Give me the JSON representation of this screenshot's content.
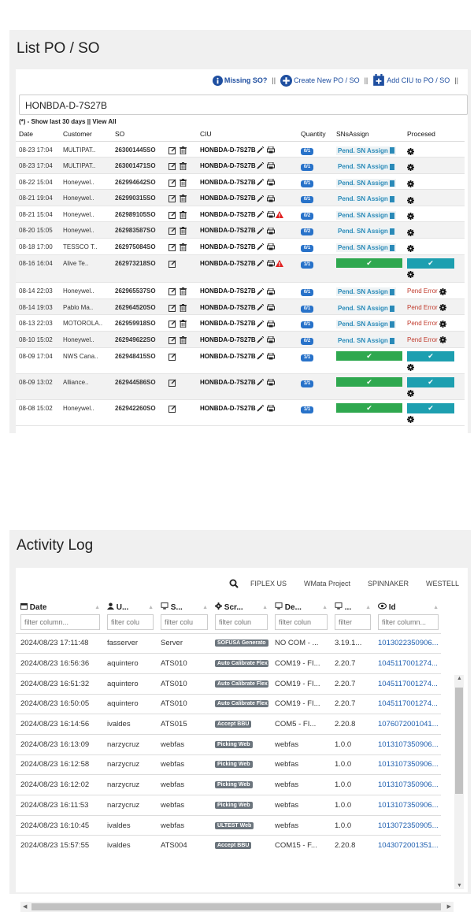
{
  "po_panel": {
    "title": "List PO / SO",
    "toolbar": {
      "missing": "Missing SO?",
      "create": "Create New PO / SO",
      "add_ciu": "Add CIU to PO / SO",
      "sep": "||"
    },
    "search_value": "HONBDA-D-7S27B",
    "show_last": "(*) - Show last 30 days || View All",
    "columns": [
      "Date",
      "Customer",
      "SO",
      "CIU",
      "Quantity",
      "SNsAssign",
      "Procesed"
    ],
    "rows": [
      {
        "date": "08-23 17:04",
        "customer": "MULTIPAT..",
        "so": "263001445SO",
        "ciu": "HONBDA-D-7S27B",
        "qty": "0/1",
        "assign": "Pend. SN Assign",
        "processed": "",
        "trash": true,
        "warn": false,
        "alt": false
      },
      {
        "date": "08-23 17:04",
        "customer": "MULTIPAT..",
        "so": "263001471SO",
        "ciu": "HONBDA-D-7S27B",
        "qty": "0/1",
        "assign": "Pend. SN Assign",
        "processed": "",
        "trash": true,
        "warn": false,
        "alt": true
      },
      {
        "date": "08-22 15:04",
        "customer": "Honeywel..",
        "so": "262994642SO",
        "ciu": "HONBDA-D-7S27B",
        "qty": "0/1",
        "assign": "Pend. SN Assign",
        "processed": "",
        "trash": true,
        "warn": false,
        "alt": false
      },
      {
        "date": "08-21 19:04",
        "customer": "Honeywel..",
        "so": "262990315SO",
        "ciu": "HONBDA-D-7S27B",
        "qty": "0/1",
        "assign": "Pend. SN Assign",
        "processed": "",
        "trash": true,
        "warn": false,
        "alt": true
      },
      {
        "date": "08-21 15:04",
        "customer": "Honeywel..",
        "so": "262989105SO",
        "ciu": "HONBDA-D-7S27B",
        "qty": "0/2",
        "assign": "Pend. SN Assign",
        "processed": "",
        "trash": true,
        "warn": true,
        "alt": false
      },
      {
        "date": "08-20 15:05",
        "customer": "Honeywel..",
        "so": "262983587SO",
        "ciu": "HONBDA-D-7S27B",
        "qty": "0/2",
        "assign": "Pend. SN Assign",
        "processed": "",
        "trash": true,
        "warn": false,
        "alt": true
      },
      {
        "date": "08-18 17:00",
        "customer": "TESSCO T..",
        "so": "262975084SO",
        "ciu": "HONBDA-D-7S27B",
        "qty": "0/1",
        "assign": "Pend. SN Assign",
        "processed": "",
        "trash": true,
        "warn": false,
        "alt": false
      },
      {
        "date": "08-16 16:04",
        "customer": "Alive Te..",
        "so": "262973218SO",
        "ciu": "HONBDA-D-7S27B",
        "qty": "1/1",
        "assign": "✔",
        "processed": "✔",
        "trash": false,
        "warn": true,
        "alt": true
      },
      {
        "date": "08-14 22:03",
        "customer": "Honeywel..",
        "so": "262965537SO",
        "ciu": "HONBDA-D-7S27B",
        "qty": "0/1",
        "assign": "Pend. SN Assign",
        "processed": "Pend Error",
        "trash": true,
        "warn": false,
        "alt": false
      },
      {
        "date": "08-14 19:03",
        "customer": "Pablo Ma..",
        "so": "262964520SO",
        "ciu": "HONBDA-D-7S27B",
        "qty": "0/1",
        "assign": "Pend. SN Assign",
        "processed": "Pend Error",
        "trash": true,
        "warn": false,
        "alt": true
      },
      {
        "date": "08-13 22:03",
        "customer": "MOTOROLA..",
        "so": "262959918SO",
        "ciu": "HONBDA-D-7S27B",
        "qty": "0/1",
        "assign": "Pend. SN Assign",
        "processed": "Pend Error",
        "trash": true,
        "warn": false,
        "alt": false
      },
      {
        "date": "08-10 15:02",
        "customer": "Honeywel..",
        "so": "262949622SO",
        "ciu": "HONBDA-D-7S27B",
        "qty": "0/2",
        "assign": "Pend. SN Assign",
        "processed": "Pend Error",
        "trash": true,
        "warn": false,
        "alt": true
      },
      {
        "date": "08-09 17:04",
        "customer": "NWS Cana..",
        "so": "262948415SO",
        "ciu": "HONBDA-D-7S27B",
        "qty": "1/1",
        "assign": "✔",
        "processed": "✔",
        "trash": false,
        "warn": false,
        "alt": false
      },
      {
        "date": "08-09 13:02",
        "customer": "Alliance..",
        "so": "262944586SO",
        "ciu": "HONBDA-D-7S27B",
        "qty": "1/1",
        "assign": "✔",
        "processed": "✔",
        "trash": false,
        "warn": false,
        "alt": true
      },
      {
        "date": "08-08 15:02",
        "customer": "Honeywel..",
        "so": "262942260SO",
        "ciu": "HONBDA-D-7S27B",
        "qty": "1/1",
        "assign": "✔",
        "processed": "✔",
        "trash": false,
        "warn": false,
        "alt": false
      }
    ]
  },
  "activity": {
    "title": "Activity Log",
    "filters": [
      "FIPLEX US",
      "WMata Project",
      "SPINNAKER",
      "WESTELL"
    ],
    "columns": [
      "Date",
      "U...",
      "S...",
      "Scr...",
      "De...",
      "...",
      "Id"
    ],
    "filter_placeholders": [
      "filter column...",
      "filter colu",
      "filter colu",
      "filter colun",
      "filter colun",
      "filter",
      "filter column..."
    ],
    "rows": [
      {
        "date": "2024/08/23 17:11:48",
        "user": "fasserver",
        "station": "Server",
        "screen": "SOFUSA Generato",
        "device": "NO COM - ...",
        "ver": "3.19.1...",
        "id": "1013022350906..."
      },
      {
        "date": "2024/08/23 16:56:36",
        "user": "aquintero",
        "station": "ATS010",
        "screen": "Auto Calibrate Flex",
        "device": "COM19 - FI...",
        "ver": "2.20.7",
        "id": "1045117001274..."
      },
      {
        "date": "2024/08/23 16:51:32",
        "user": "aquintero",
        "station": "ATS010",
        "screen": "Auto Calibrate Flex",
        "device": "COM19 - FI...",
        "ver": "2.20.7",
        "id": "1045117001274..."
      },
      {
        "date": "2024/08/23 16:50:05",
        "user": "aquintero",
        "station": "ATS010",
        "screen": "Auto Calibrate Flex",
        "device": "COM19 - FI...",
        "ver": "2.20.7",
        "id": "1045117001274..."
      },
      {
        "date": "2024/08/23 16:14:56",
        "user": "ivaldes",
        "station": "ATS015",
        "screen": "Accept BBU",
        "device": "COM5 - FI...",
        "ver": "2.20.8",
        "id": "1076072001041..."
      },
      {
        "date": "2024/08/23 16:13:09",
        "user": "narzycruz",
        "station": "webfas",
        "screen": "Picking Web",
        "device": "webfas",
        "ver": "1.0.0",
        "id": "1013107350906..."
      },
      {
        "date": "2024/08/23 16:12:58",
        "user": "narzycruz",
        "station": "webfas",
        "screen": "Picking Web",
        "device": "webfas",
        "ver": "1.0.0",
        "id": "1013107350906..."
      },
      {
        "date": "2024/08/23 16:12:02",
        "user": "narzycruz",
        "station": "webfas",
        "screen": "Picking Web",
        "device": "webfas",
        "ver": "1.0.0",
        "id": "1013107350906..."
      },
      {
        "date": "2024/08/23 16:11:53",
        "user": "narzycruz",
        "station": "webfas",
        "screen": "Picking Web",
        "device": "webfas",
        "ver": "1.0.0",
        "id": "1013107350906..."
      },
      {
        "date": "2024/08/23 16:10:45",
        "user": "ivaldes",
        "station": "webfas",
        "screen": "ULTEST Web",
        "device": "webfas",
        "ver": "1.0.0",
        "id": "1013072350905..."
      },
      {
        "date": "2024/08/23 15:57:55",
        "user": "ivaldes",
        "station": "ATS004",
        "screen": "Accept BBU",
        "device": "COM15 - F...",
        "ver": "2.20.8",
        "id": "1043072001351..."
      }
    ]
  },
  "colors": {
    "accent": "#2872c9",
    "success": "#2fa84f",
    "teal": "#1d9fb0",
    "error": "#c0392b",
    "badge": "#6c757d"
  }
}
